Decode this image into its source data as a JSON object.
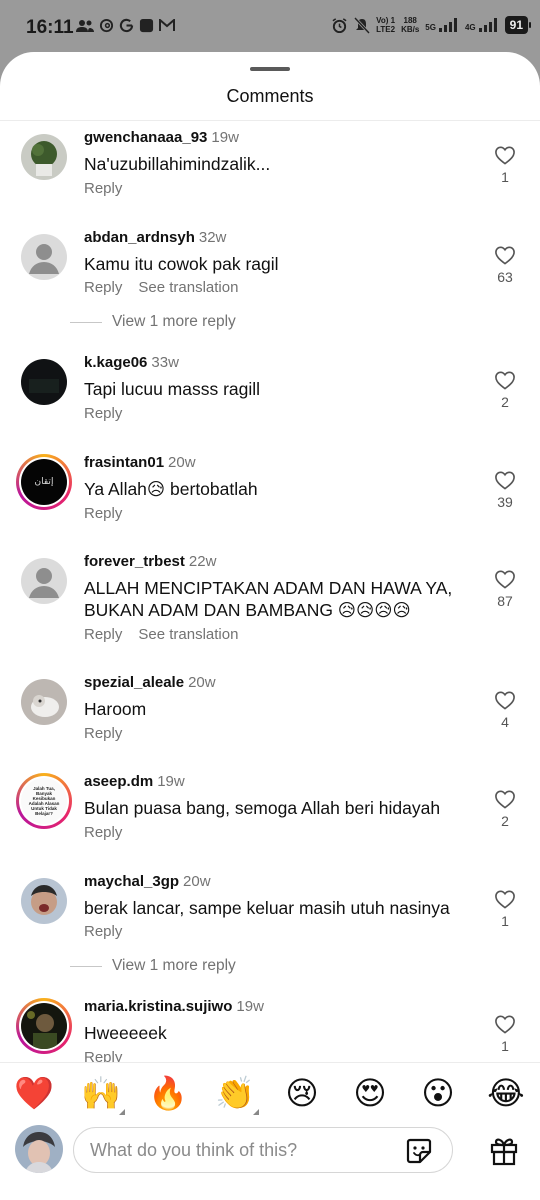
{
  "status_bar": {
    "time": "16:11",
    "network_label_top": "Vo) 1",
    "network_label_bottom": "LTE2",
    "speed_value": "188",
    "speed_unit": "KB/s",
    "net_5g": "5G",
    "net_4g": "4G",
    "battery": "91"
  },
  "sheet": {
    "title": "Comments"
  },
  "comments": [
    {
      "username": "gwenchanaaa_93",
      "time": "19w",
      "text": "Na'uzubillahimindzalik...",
      "actions": [
        "Reply"
      ],
      "likes": "1"
    },
    {
      "username": "abdan_ardnsyh",
      "time": "32w",
      "text": "Kamu itu cowok pak ragil",
      "actions": [
        "Reply",
        "See translation"
      ],
      "likes": "63",
      "more_replies": "View 1 more reply"
    },
    {
      "username": "k.kage06",
      "time": "33w",
      "text": "Tapi lucuu masss ragill",
      "actions": [
        "Reply"
      ],
      "likes": "2"
    },
    {
      "username": "frasintan01",
      "time": "20w",
      "text": "Ya Allah😥 bertobatlah",
      "actions": [
        "Reply"
      ],
      "likes": "39"
    },
    {
      "username": "forever_trbest",
      "time": "22w",
      "text": "ALLAH MENCIPTAKAN ADAM DAN HAWA YA, BUKAN ADAM DAN BAMBANG 😥😥😥😥",
      "actions": [
        "Reply",
        "See translation"
      ],
      "likes": "87"
    },
    {
      "username": "spezial_aleale",
      "time": "20w",
      "text": "Haroom",
      "actions": [
        "Reply"
      ],
      "likes": "4"
    },
    {
      "username": "aseep.dm",
      "time": "19w",
      "text": "Bulan puasa bang, semoga Allah beri hidayah",
      "actions": [
        "Reply"
      ],
      "likes": "2"
    },
    {
      "username": "maychal_3gp",
      "time": "20w",
      "text": "berak lancar, sampe keluar masih utuh nasinya",
      "actions": [
        "Reply"
      ],
      "likes": "1",
      "more_replies": "View 1 more reply"
    },
    {
      "username": "maria.kristina.sujiwo",
      "time": "19w",
      "text": "Hweeeeek",
      "actions": [
        "Reply"
      ],
      "likes": "1"
    }
  ],
  "avatar_badge_text": "إتقان",
  "avatar_poster_text": "Jalah Tua, Banyak Kesibukan Adalah Alasan Untuk Tidak Belajar?",
  "emoji_bar": [
    "❤️",
    "🙌",
    "🔥",
    "👏",
    "😢",
    "😍",
    "😮",
    "😂"
  ],
  "input": {
    "placeholder": "What do you think of this?"
  },
  "icons": {
    "like": "heart-outline-icon",
    "sticker": "sticker-icon",
    "gift": "gift-icon"
  },
  "colors": {
    "story_ring": "#e8256a",
    "muted_text": "#737373",
    "status_bar_bg": "#9a9a9a"
  }
}
